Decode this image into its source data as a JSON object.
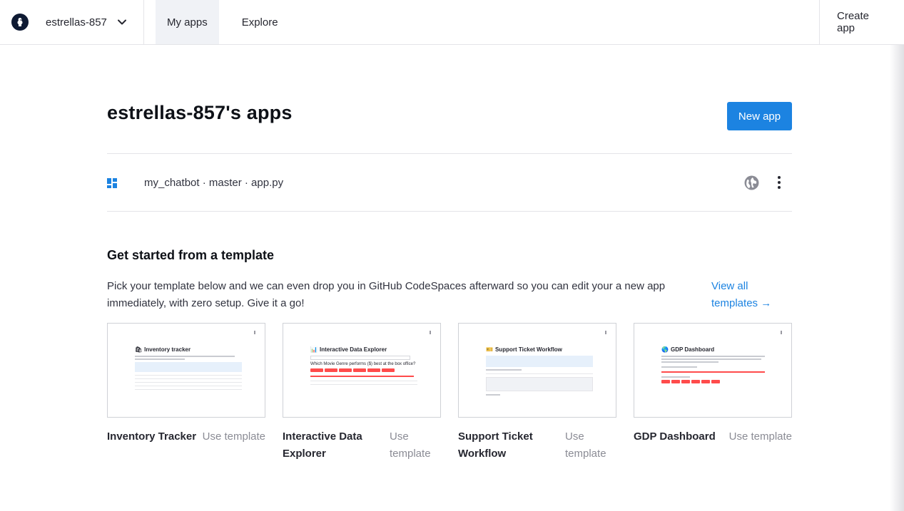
{
  "header": {
    "workspace_name": "estrellas-857",
    "tabs": [
      {
        "label": "My apps",
        "active": true
      },
      {
        "label": "Explore",
        "active": false
      }
    ],
    "create_app_label": "Create app"
  },
  "page": {
    "title": "estrellas-857's apps",
    "new_app_label": "New app"
  },
  "apps": [
    {
      "label": "my_chatbot · master · app.py",
      "icon": "app-grid-icon",
      "visibility_icon": "globe-icon"
    }
  ],
  "templates_section": {
    "title": "Get started from a template",
    "description": "Pick your template below and we can even drop you in GitHub CodeSpaces afterward so you can edit your a new app immediately, with zero setup. Give it a go!",
    "view_all_line1": "View all",
    "view_all_line2": "templates →",
    "use_template_label": "Use template",
    "templates": [
      {
        "name": "Inventory Tracker",
        "preview_title": "Inventory tracker",
        "preview_icon": "🛍"
      },
      {
        "name": "Interactive Data Explorer",
        "preview_title": "Interactive Data Explorer",
        "preview_icon": "📊",
        "preview_question": "Which Movie Genre performs ($) best at the box office?"
      },
      {
        "name": "Support Ticket Workflow",
        "preview_title": "Support Ticket Workflow",
        "preview_icon": "🎫"
      },
      {
        "name": "GDP Dashboard",
        "preview_title": "GDP Dashboard",
        "preview_icon": "🌎"
      }
    ]
  },
  "colors": {
    "primary": "#1c83e1",
    "text": "#262730",
    "muted": "#8b8c95",
    "accent_red": "#ff4b4b"
  }
}
